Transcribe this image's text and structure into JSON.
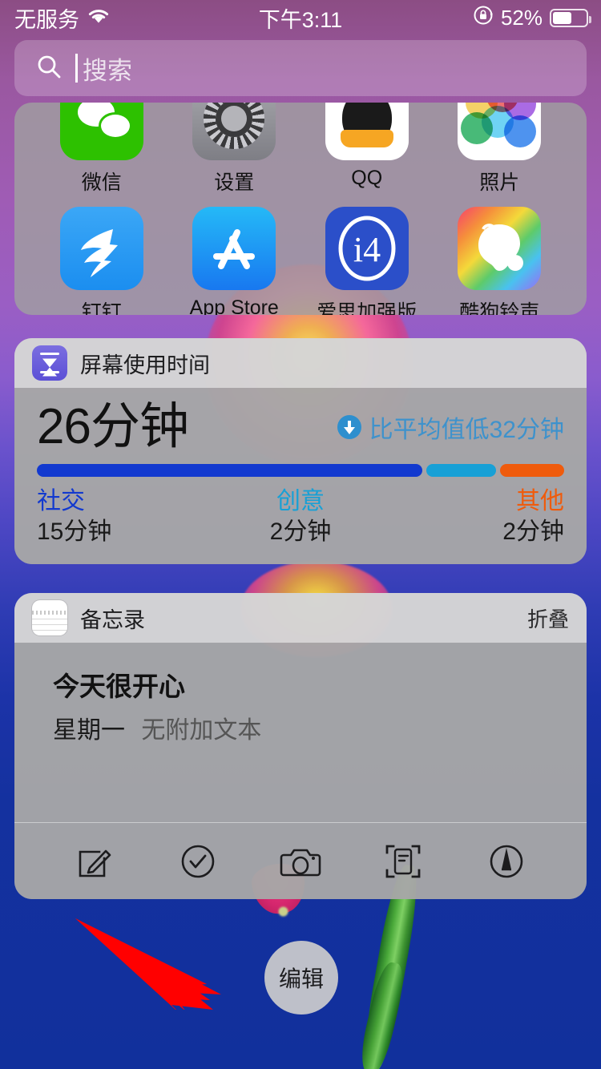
{
  "status_bar": {
    "carrier": "无服务",
    "wifi_icon": "wifi-icon",
    "time": "下午3:11",
    "rotation_lock_icon": "rotation-lock-icon",
    "battery_percent": "52%",
    "battery_level": 52
  },
  "search": {
    "icon": "search-icon",
    "placeholder": "搜索",
    "value": ""
  },
  "widgets": {
    "siri_suggestions": {
      "apps": [
        {
          "label": "微信",
          "icon": "wechat-icon"
        },
        {
          "label": "设置",
          "icon": "settings-icon"
        },
        {
          "label": "QQ",
          "icon": "qq-icon"
        },
        {
          "label": "照片",
          "icon": "photos-icon"
        },
        {
          "label": "钉钉",
          "icon": "dingtalk-icon"
        },
        {
          "label": "App Store",
          "icon": "app-store-icon"
        },
        {
          "label": "爱思加强版",
          "icon": "i4-icon"
        },
        {
          "label": "酷狗铃声",
          "icon": "kugou-ringtone-icon"
        }
      ]
    },
    "screen_time": {
      "icon": "hourglass-icon",
      "title": "屏幕使用时间",
      "total": "26分钟",
      "comparison_icon": "arrow-down-circle-icon",
      "comparison": "比平均值低32分钟",
      "categories": [
        {
          "name": "社交",
          "value": "15分钟",
          "color": "#1239cf",
          "percent": 72
        },
        {
          "name": "创意",
          "value": "2分钟",
          "color": "#17a0d6",
          "percent": 13
        },
        {
          "name": "其他",
          "value": "2分钟",
          "color": "#ef5b0c",
          "percent": 12
        }
      ]
    },
    "notes": {
      "icon": "notes-icon",
      "title": "备忘录",
      "action": "折叠",
      "note": {
        "title": "今天很开心",
        "day": "星期一",
        "preview": "无附加文本"
      },
      "tools": [
        {
          "icon": "compose-icon"
        },
        {
          "icon": "checklist-icon"
        },
        {
          "icon": "camera-icon"
        },
        {
          "icon": "scan-document-icon"
        },
        {
          "icon": "markup-pen-icon"
        }
      ]
    }
  },
  "edit_button": {
    "label": "编辑"
  },
  "annotation": {
    "arrow_color": "#ff0000",
    "icon": "red-arrow-annotation"
  }
}
